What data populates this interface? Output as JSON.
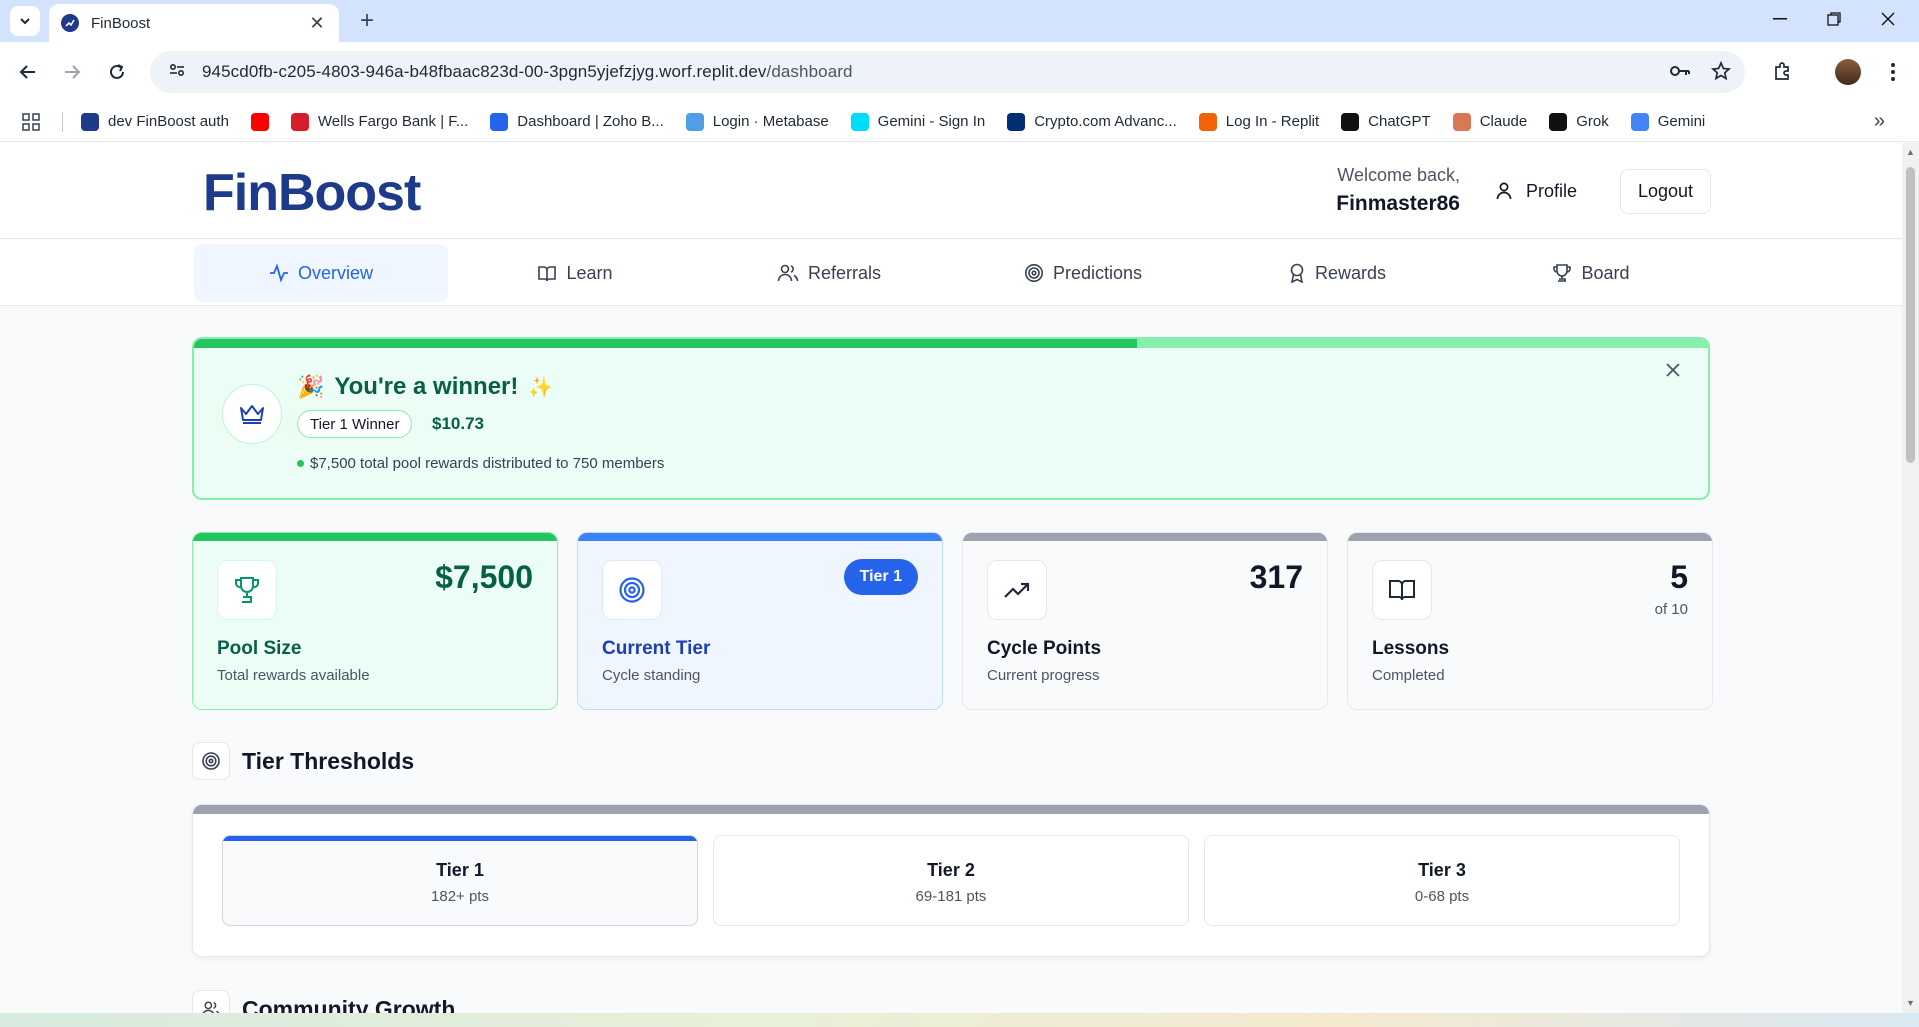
{
  "browser": {
    "tab_title": "FinBoost",
    "url_host": "945cd0fb-c205-4803-946a-b48fbaac823d-00-3pgn5yjefzjyg.worf.replit.dev",
    "url_path": "/dashboard",
    "bookmarks": [
      {
        "label": "dev FinBoost auth",
        "icon": "finboost-icon",
        "color": "#1e3a8a"
      },
      {
        "label": "",
        "icon": "youtube-icon",
        "color": "#ff0000"
      },
      {
        "label": "Wells Fargo Bank | F...",
        "icon": "wellsfargo-icon",
        "color": "#d71e28"
      },
      {
        "label": "Dashboard | Zoho B...",
        "icon": "zoho-icon",
        "color": "#2563eb"
      },
      {
        "label": "Login · Metabase",
        "icon": "metabase-icon",
        "color": "#509ee3"
      },
      {
        "label": "Gemini - Sign In",
        "icon": "gemini-exchange-icon",
        "color": "#00dcfa"
      },
      {
        "label": "Crypto.com Advanc...",
        "icon": "cryptocom-icon",
        "color": "#002d74"
      },
      {
        "label": "Log In - Replit",
        "icon": "replit-icon",
        "color": "#f26207"
      },
      {
        "label": "ChatGPT",
        "icon": "chatgpt-icon",
        "color": "#111111"
      },
      {
        "label": "Claude",
        "icon": "claude-icon",
        "color": "#d97757"
      },
      {
        "label": "Grok",
        "icon": "grok-icon",
        "color": "#111111"
      },
      {
        "label": "Gemini",
        "icon": "gemini-icon",
        "color": "#4285f4"
      }
    ]
  },
  "header": {
    "logo": "FinBoost",
    "welcome": "Welcome back,",
    "username": "Finmaster86",
    "profile_label": "Profile",
    "logout_label": "Logout"
  },
  "nav": [
    {
      "label": "Overview",
      "icon": "activity-icon",
      "active": true
    },
    {
      "label": "Learn",
      "icon": "book-icon",
      "active": false
    },
    {
      "label": "Referrals",
      "icon": "users-icon",
      "active": false
    },
    {
      "label": "Predictions",
      "icon": "target-icon",
      "active": false
    },
    {
      "label": "Rewards",
      "icon": "award-icon",
      "active": false
    },
    {
      "label": "Board",
      "icon": "trophy-icon",
      "active": false
    }
  ],
  "winner": {
    "emoji": "🎉",
    "title": "You're a winner!",
    "emoji2": "✨",
    "tier_chip": "Tier 1 Winner",
    "amount": "$10.73",
    "note": "$7,500 total pool rewards distributed to 750 members",
    "progress": 0.623
  },
  "stats": [
    {
      "value": "$7,500",
      "label": "Pool Size",
      "desc": "Total rewards available",
      "icon": "trophy-icon",
      "accent": "#22c55e"
    },
    {
      "badge": "Tier 1",
      "label": "Current Tier",
      "desc": "Cycle standing",
      "icon": "target-icon",
      "accent": "#3b82f6"
    },
    {
      "value": "317",
      "label": "Cycle Points",
      "desc": "Current progress",
      "icon": "trending-up-icon",
      "accent": "#9ca3af"
    },
    {
      "value": "5",
      "sub": "of 10",
      "label": "Lessons",
      "desc": "Completed",
      "icon": "book-icon",
      "accent": "#9ca3af"
    }
  ],
  "tier_thresholds": {
    "title": "Tier Thresholds",
    "tiers": [
      {
        "name": "Tier 1",
        "range": "182+ pts",
        "active": true
      },
      {
        "name": "Tier 2",
        "range": "69-181 pts",
        "active": false
      },
      {
        "name": "Tier 3",
        "range": "0-68 pts",
        "active": false
      }
    ]
  },
  "community": {
    "title": "Community Growth"
  }
}
